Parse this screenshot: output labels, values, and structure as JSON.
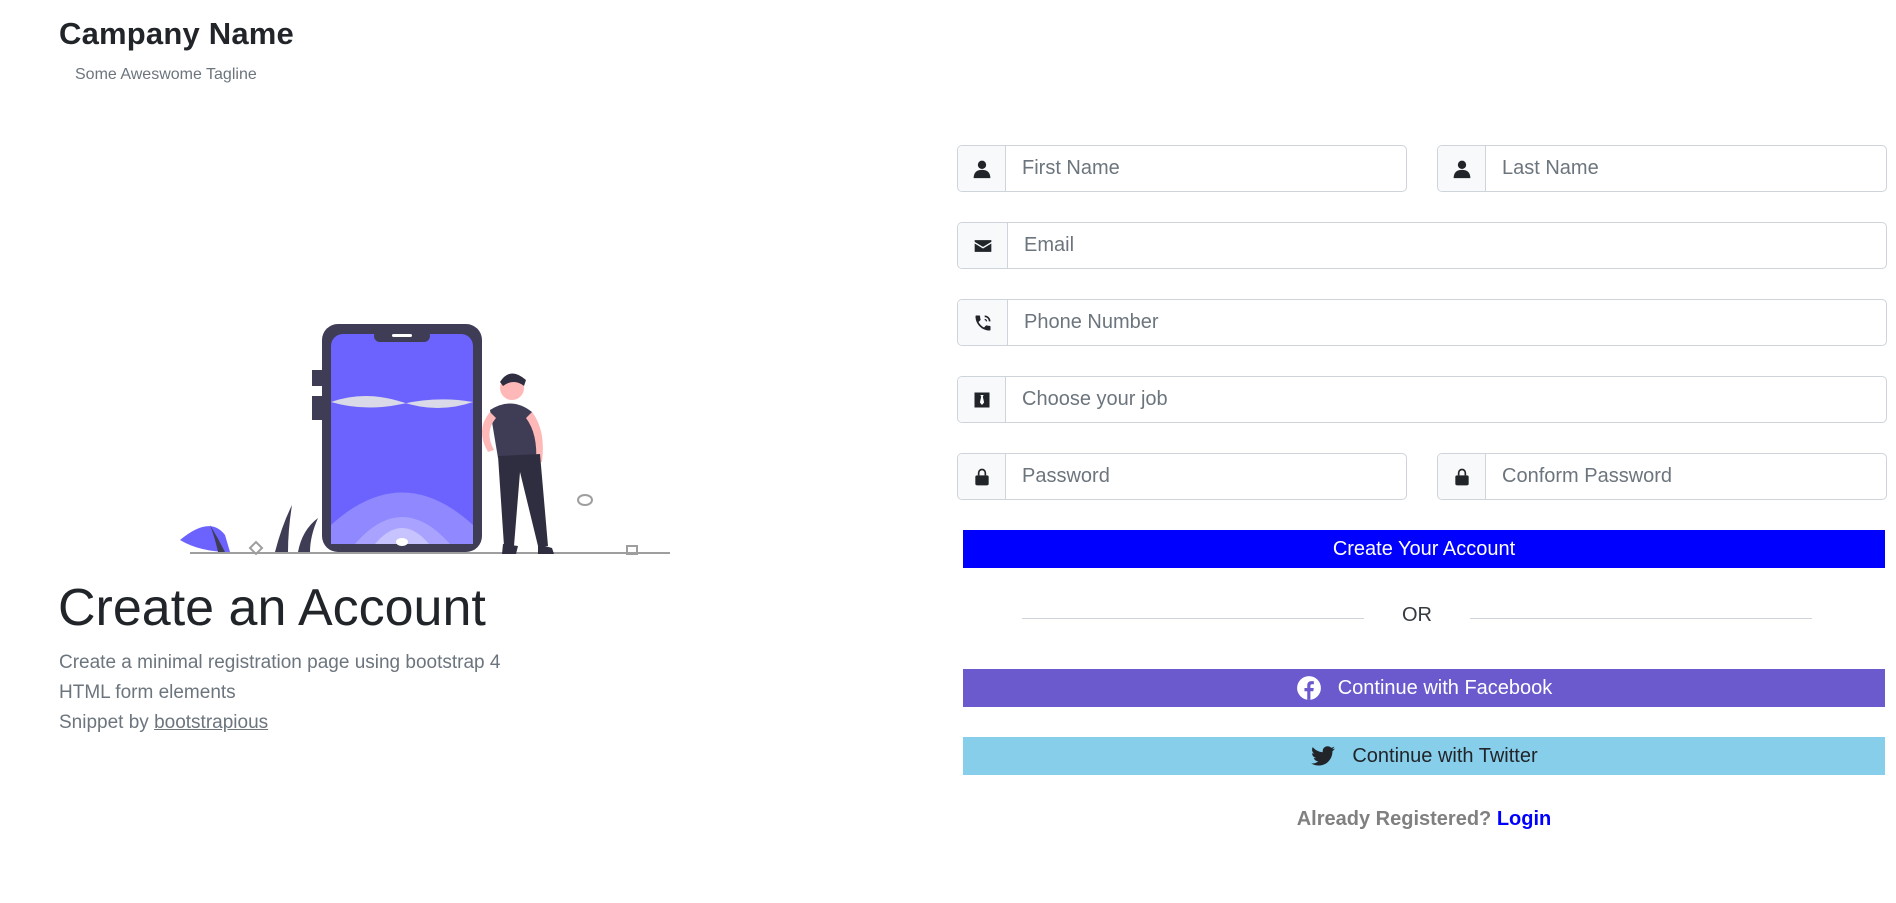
{
  "brand": {
    "name": "Campany Name",
    "tagline": "Some Aweswome Tagline"
  },
  "hero": {
    "title": "Create an Account",
    "line1": "Create a minimal registration page using bootstrap 4",
    "line2": "HTML form elements",
    "snippet_prefix": "Snippet by ",
    "snippet_link": "bootstrapious"
  },
  "form": {
    "first_name": {
      "placeholder": "First Name",
      "icon": "user-icon"
    },
    "last_name": {
      "placeholder": "Last Name",
      "icon": "user-icon"
    },
    "email": {
      "placeholder": "Email",
      "icon": "envelope-icon"
    },
    "phone": {
      "placeholder": "Phone Number",
      "icon": "phone-icon"
    },
    "job": {
      "placeholder": "Choose your job",
      "icon": "black-tie-icon"
    },
    "password": {
      "placeholder": "Password",
      "icon": "lock-icon"
    },
    "confirm_password": {
      "placeholder": "Conform Password",
      "icon": "lock-icon"
    },
    "submit_label": "Create Your Account",
    "or_label": "OR",
    "facebook_label": "Continue with Facebook",
    "twitter_label": "Continue with Twitter",
    "already_registered": "Already Registered?",
    "login_label": "Login"
  },
  "colors": {
    "primary": "#0000ff",
    "facebook": "#6a5acd",
    "twitter": "#87ceeb",
    "illustration_accent": "#6c63ff"
  }
}
